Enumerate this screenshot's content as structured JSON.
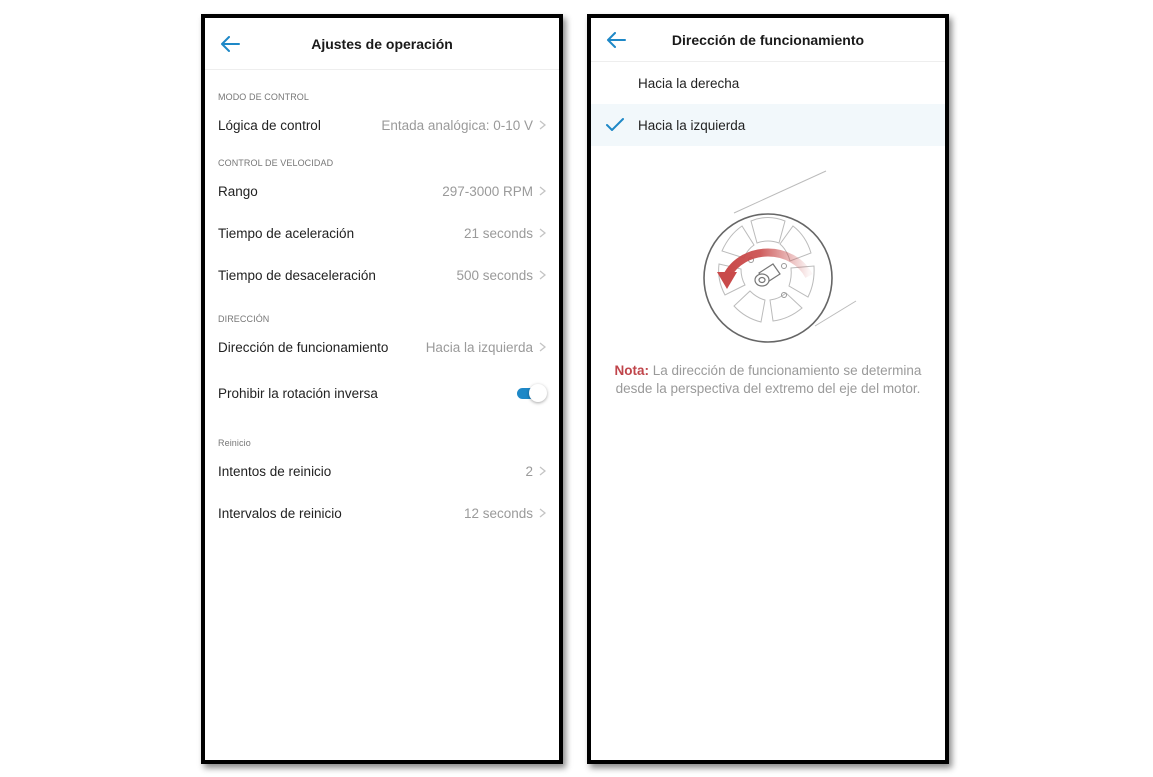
{
  "left_screen": {
    "title": "Ajustes de operación",
    "sections": [
      {
        "label": "MODO DE CONTROL",
        "rows": [
          {
            "label": "Lógica de control",
            "value": "Entada analógica: 0-10 V"
          }
        ]
      },
      {
        "label": "CONTROL DE VELOCIDAD",
        "rows": [
          {
            "label": "Rango",
            "value": "297-3000 RPM"
          },
          {
            "label": "Tiempo de aceleración",
            "value": "21 seconds"
          },
          {
            "label": "Tiempo de desaceleración",
            "value": "500 seconds"
          }
        ]
      },
      {
        "label": "DIRECCIÓN",
        "rows": [
          {
            "label": "Dirección de funcionamiento",
            "value": "Hacia la izquierda"
          }
        ],
        "toggle_row": {
          "label": "Prohibir la rotación inversa",
          "enabled": true
        }
      },
      {
        "label": "Reinicio",
        "rows": [
          {
            "label": "Intentos de reinicio",
            "value": "2"
          },
          {
            "label": "Intervalos de reinicio",
            "value": "12 seconds"
          }
        ]
      }
    ]
  },
  "right_screen": {
    "title": "Dirección de funcionamiento",
    "options": [
      {
        "label": "Hacia la derecha",
        "selected": false
      },
      {
        "label": "Hacia la izquierda",
        "selected": true
      }
    ],
    "note_label": "Nota:",
    "note_text": " La dirección de funcionamiento se determina desde la perspectiva del extremo del eje del motor."
  },
  "colors": {
    "accent": "#1e88c7",
    "note_red": "#c0454b",
    "arrow_red": "#c94a4a",
    "selected_bg": "#f2f8fb"
  },
  "icons": {
    "back": "arrow-left-icon",
    "chevron": "chevron-right-icon",
    "check": "check-icon"
  }
}
